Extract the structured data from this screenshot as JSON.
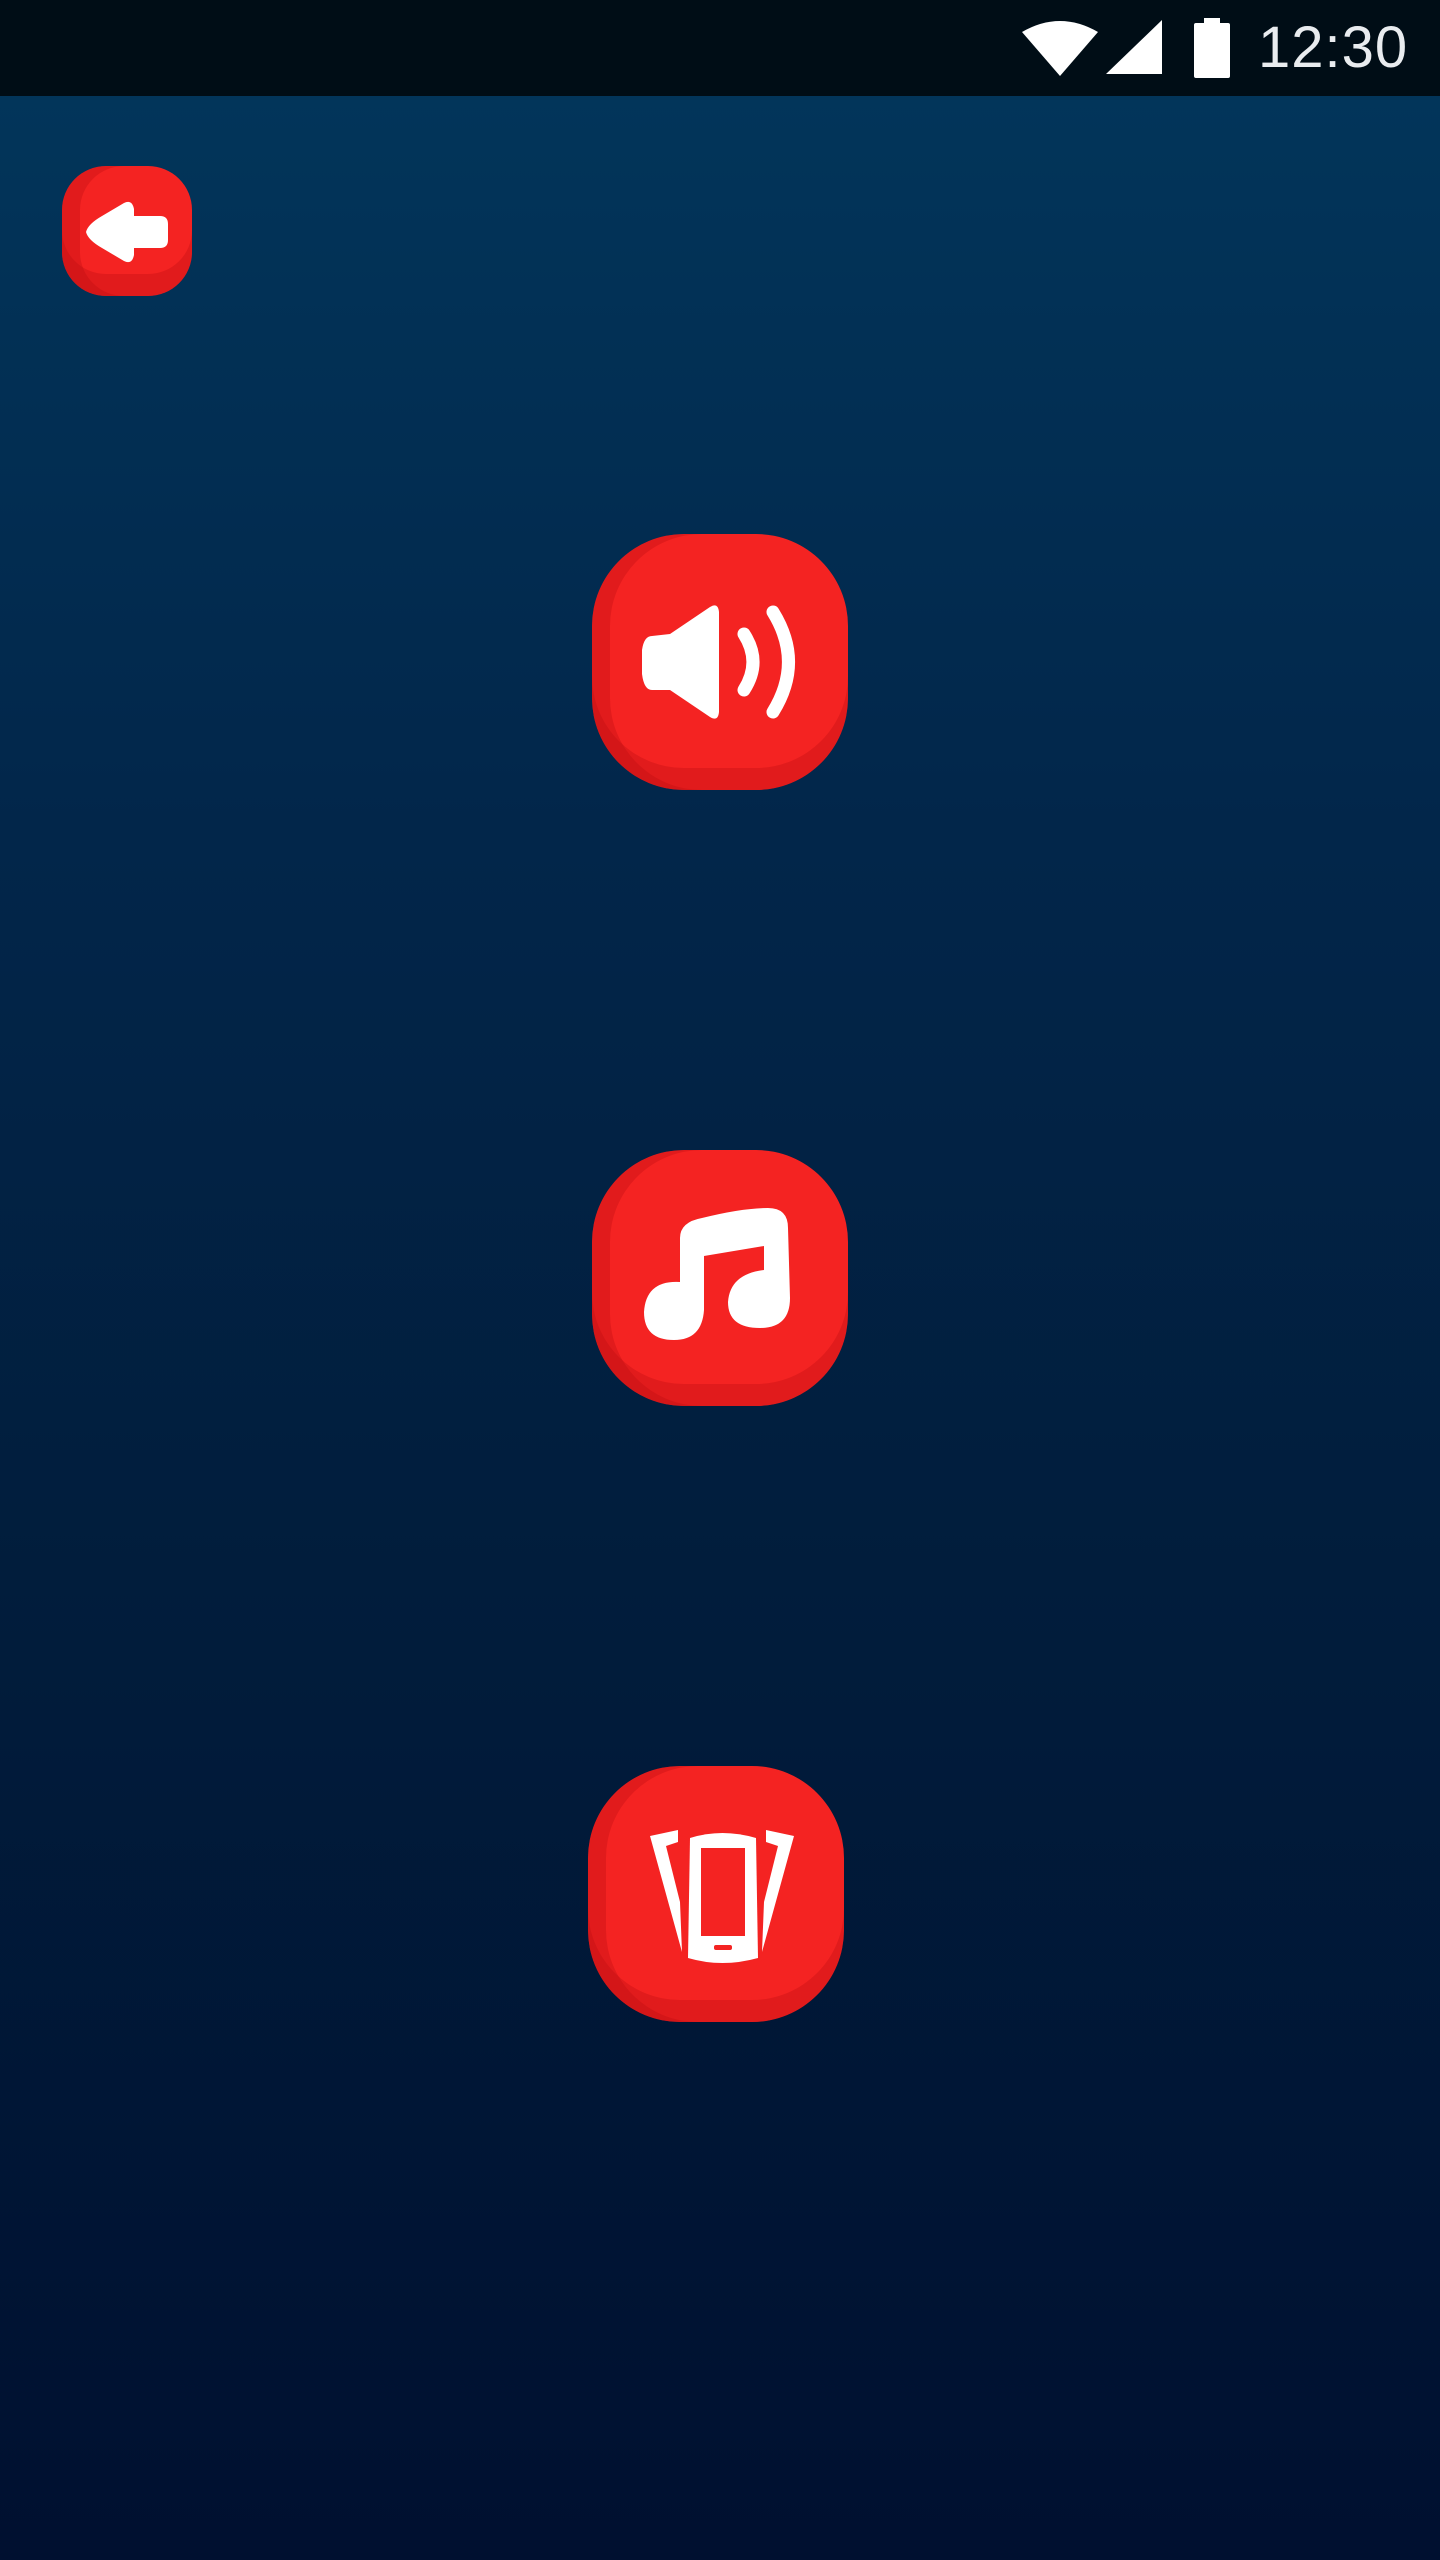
{
  "status_bar": {
    "time": "12:30",
    "icons": [
      "wifi-icon",
      "cellular-signal-icon",
      "battery-icon"
    ]
  },
  "colors": {
    "background_top": "#02355a",
    "background_bottom": "#001030",
    "button": "#f42322",
    "icon": "#ffffff"
  },
  "buttons": [
    {
      "name": "back-button",
      "icon": "arrow-left-icon"
    },
    {
      "name": "sound-button",
      "icon": "speaker-volume-icon"
    },
    {
      "name": "music-button",
      "icon": "music-note-icon"
    },
    {
      "name": "vibrate-button",
      "icon": "phone-vibrate-icon"
    }
  ]
}
